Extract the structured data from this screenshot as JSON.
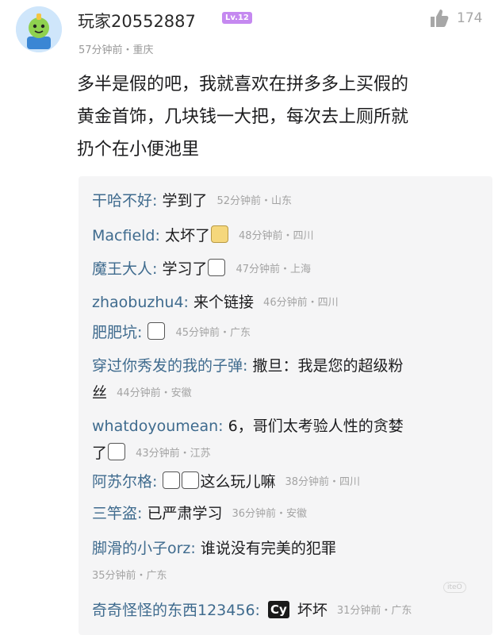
{
  "post": {
    "username": "玩家20552887",
    "level": "Lv.12",
    "likes": "174",
    "meta": "57分钟前・重庆",
    "text": "多半是假的吧，我就喜欢在拼多多上买假的\n黄金首饰，几块钱一大把，每次去上厕所就\n扔个在小便池里"
  },
  "replies": [
    {
      "name": "干哈不好:",
      "text": "学到了",
      "meta": "52分钟前・山东"
    },
    {
      "name": "Macfield:",
      "text": "太坏了",
      "emoji": "dog",
      "meta": "48分钟前・四川"
    },
    {
      "name": "魔王大人:",
      "text": "学习了",
      "emoji": "panda",
      "meta": "47分钟前・上海"
    },
    {
      "name": "zhaobuzhu4:",
      "text": "来个链接",
      "meta": "46分钟前・四川"
    },
    {
      "name": "肥肥坑:",
      "text": "",
      "emoji": "panda",
      "meta": "45分钟前・广东"
    },
    {
      "name": "穿过你秀发的我的子弹:",
      "text": "撒旦：我是您的超级粉",
      "text2": "丝",
      "meta": "44分钟前・安徽"
    },
    {
      "name": "whatdoyoumean:",
      "text": "6，哥们太考验人性的贪婪",
      "text2": "了",
      "emoji": "panda",
      "meta": "43分钟前・江苏"
    },
    {
      "name": "阿苏尔格:",
      "text": "这么玩儿嘛",
      "emoji_prefix": "panda panda",
      "meta": "38分钟前・四川"
    },
    {
      "name": "三竿盗:",
      "text": "已严肃学习",
      "meta": "36分钟前・安徽"
    },
    {
      "name": "脚滑的小子orz:",
      "text": "谁说没有完美的犯罪",
      "meta": "35分钟前・广东"
    },
    {
      "name": "奇奇怪怪的东西123456:",
      "badge": "Cy",
      "text": "坏坏",
      "meta": "31分钟前・广东"
    }
  ],
  "icons": {
    "like": "thumbs-up-icon",
    "avatar": "cartoon-avatar"
  },
  "watermark": "iteO"
}
